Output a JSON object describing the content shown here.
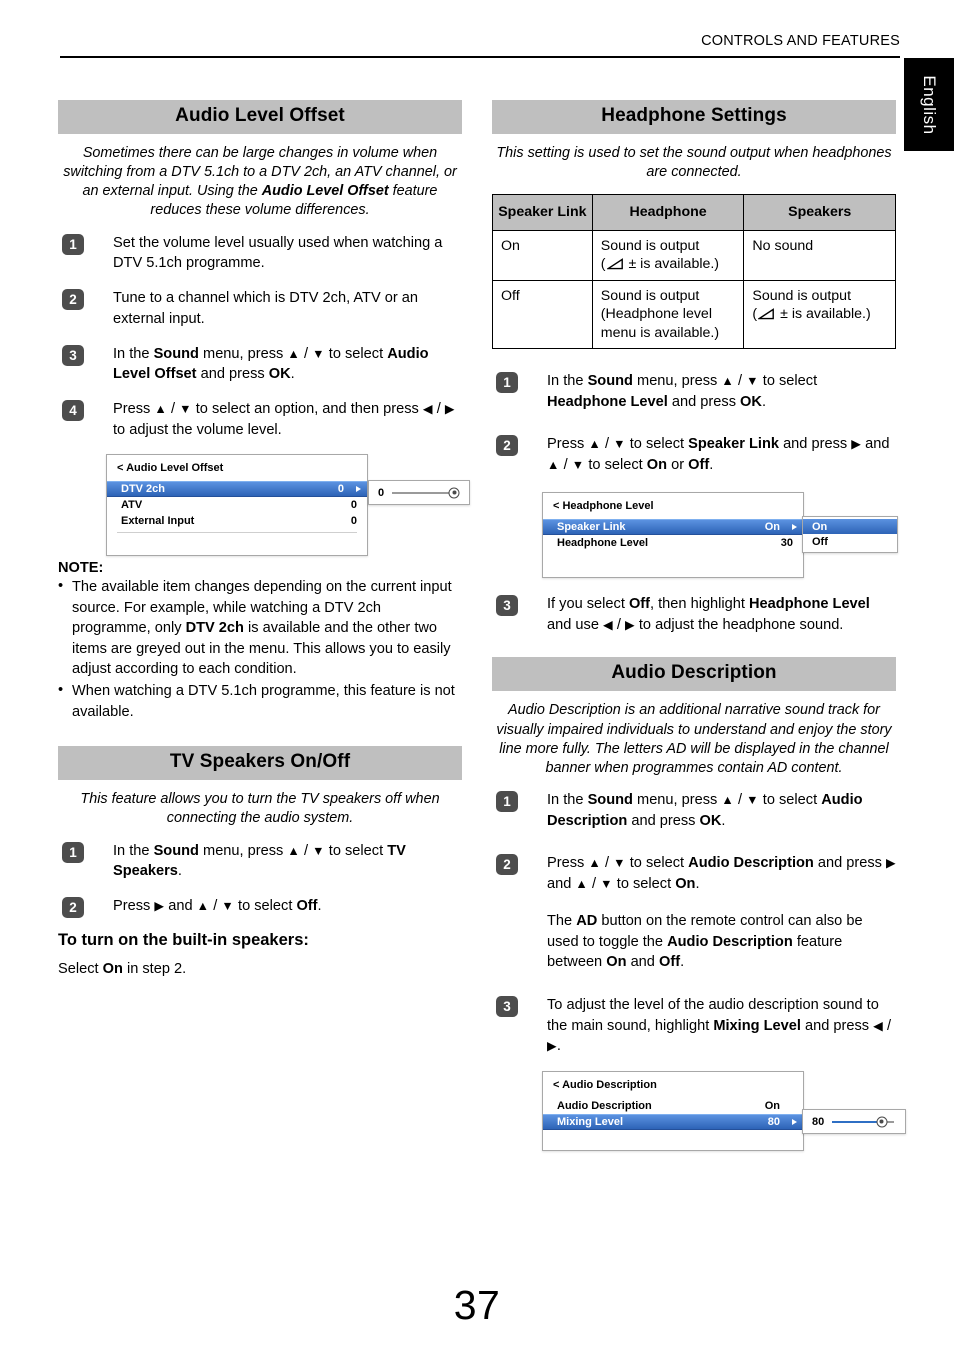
{
  "header": {
    "running_head": "CONTROLS AND FEATURES",
    "language_tab": "English"
  },
  "page_number": "37",
  "left_column": {
    "sections": [
      {
        "title": "Audio Level Offset",
        "blurb_plain": "Sometimes there can be large changes in volume when switching from a DTV 5.1ch to a DTV 2ch, an ATV channel, or an external input. Using the Audio Level Offset feature reduces these volume differences.",
        "steps": [
          {
            "num": "1",
            "text": "Set the volume level usually used when watching a DTV 5.1ch programme."
          },
          {
            "num": "2",
            "text": "Tune to a channel which is DTV 2ch, ATV or an external input."
          },
          {
            "num": "3",
            "text": "In the Sound menu, press ▲ / ▼ to select Audio Level Offset and press OK."
          },
          {
            "num": "4",
            "text": "Press ▲ / ▼ to select an option, and then press ◀ / ▶ to adjust the volume level."
          }
        ],
        "osd": {
          "title": "< Audio Level Offset",
          "rows": [
            {
              "label": "DTV 2ch",
              "value": "0",
              "selected": true
            },
            {
              "label": "ATV",
              "value": "0",
              "selected": false
            },
            {
              "label": "External Input",
              "value": "0",
              "selected": false
            }
          ],
          "popup_value": "0",
          "slider_percent": 100,
          "slider_filled": false
        },
        "note_title": "NOTE:",
        "notes": [
          "The available item changes depending on the current input source. For example, while watching a DTV 2ch programme, only DTV 2ch is available and the other two items are greyed out in the menu. This allows you to easily adjust according to each condition.",
          "When watching a DTV 5.1ch programme, this feature is not available."
        ]
      },
      {
        "title": "TV Speakers On/Off",
        "blurb_plain": "This feature allows you to turn the TV speakers off when connecting the audio system.",
        "steps": [
          {
            "num": "1",
            "text": "In the Sound menu, press ▲ / ▼ to select TV Speakers."
          },
          {
            "num": "2",
            "text": "Press ▶ and ▲ / ▼ to select Off."
          }
        ],
        "subhead": "To turn on the built-in speakers:",
        "closing": "Select On in step 2."
      }
    ]
  },
  "right_column": {
    "sections": [
      {
        "title": "Headphone Settings",
        "blurb_plain": "This setting is used to set the sound output when headphones are connected.",
        "table": {
          "headers": [
            "Speaker Link",
            "Headphone",
            "Speakers"
          ],
          "rows": [
            {
              "speaker_link": "On",
              "headphone_line1": "Sound is output",
              "headphone_line2": "± is available.)",
              "headphone_has_icon": true,
              "speakers_line1": "No sound",
              "speakers_line2": "",
              "speakers_has_icon": false
            },
            {
              "speaker_link": "Off",
              "headphone_line1": "Sound is output",
              "headphone_line2": "(Headphone level menu is available.)",
              "headphone_has_icon": false,
              "speakers_line1": "Sound is output",
              "speakers_line2": "± is available.)",
              "speakers_has_icon": true
            }
          ]
        },
        "steps": [
          {
            "num": "1",
            "text": "In the Sound menu, press ▲ / ▼ to select Headphone Level and press OK."
          },
          {
            "num": "2",
            "text": "Press ▲ / ▼ to select Speaker Link and press ▶ and ▲ / ▼ to select On or Off."
          },
          {
            "num": "3",
            "text": "If you select Off, then highlight Headphone Level and use ◀ / ▶ to adjust the headphone sound."
          }
        ],
        "osd": {
          "title": "< Headphone Level",
          "rows": [
            {
              "label": "Speaker Link",
              "value": "On",
              "selected": true
            },
            {
              "label": "Headphone Level",
              "value": "30",
              "selected": false
            }
          ],
          "options": [
            {
              "label": "On",
              "selected": true
            },
            {
              "label": "Off",
              "selected": false
            }
          ]
        }
      },
      {
        "title": "Audio Description",
        "blurb_plain": "Audio Description is an additional narrative sound track for visually impaired individuals to understand and enjoy the story line more fully. The letters AD will be displayed in the channel banner when programmes contain AD content.",
        "steps": [
          {
            "num": "1",
            "text": "In the Sound menu, press ▲ / ▼ to select Audio Description and press OK."
          },
          {
            "num": "2",
            "text": "Press ▲ / ▼ to select Audio Description and press ▶ and ▲ / ▼ to select On.",
            "text2": "The AD button on the remote control can also be used to toggle the Audio Description feature between On and Off."
          },
          {
            "num": "3",
            "text": "To adjust the level of the audio description sound to the main sound, highlight Mixing Level and press ◀ / ▶."
          }
        ],
        "osd": {
          "title": "< Audio Description",
          "rows": [
            {
              "label": "Audio Description",
              "value": "On",
              "selected": false
            },
            {
              "label": "Mixing Level",
              "value": "80",
              "selected": true
            }
          ],
          "popup_value": "80",
          "slider_percent": 80,
          "slider_filled": true
        }
      }
    ]
  }
}
